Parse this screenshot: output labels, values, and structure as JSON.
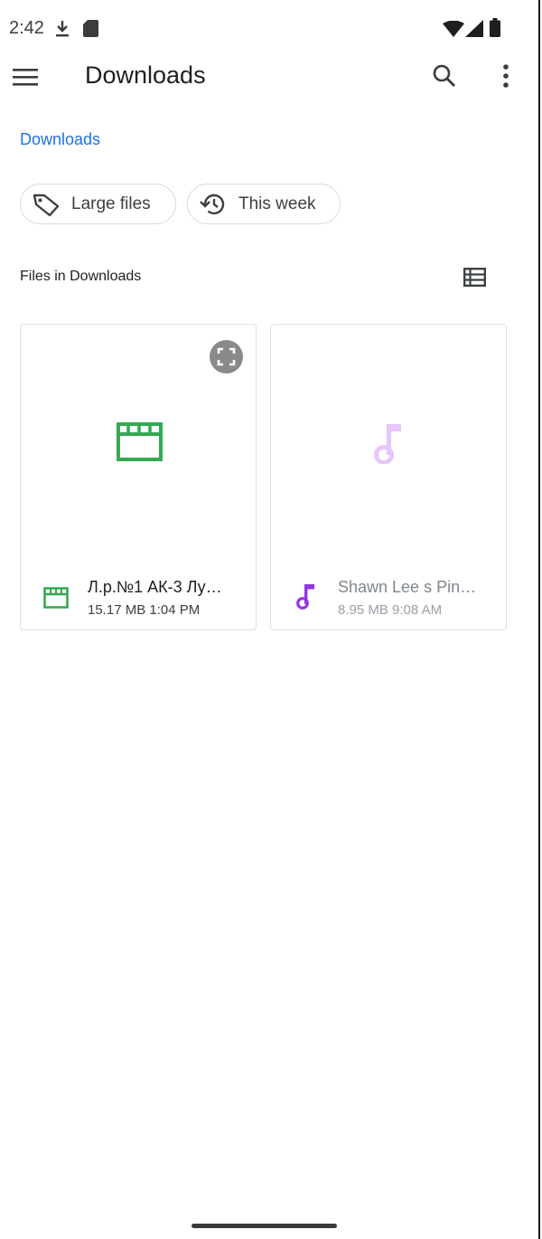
{
  "status_bar": {
    "time": "2:42",
    "icons": [
      "download-icon",
      "sd-card-icon",
      "wifi-icon",
      "cell-signal-icon",
      "battery-icon"
    ]
  },
  "app_bar": {
    "title": "Downloads",
    "icons": [
      "menu-icon",
      "search-icon",
      "more-vert-icon"
    ]
  },
  "breadcrumb": {
    "label": "Downloads",
    "color": "#1a73e8"
  },
  "chips": [
    {
      "label": "Large files",
      "icon": "label-tag-icon"
    },
    {
      "label": "This week",
      "icon": "history-icon"
    }
  ],
  "section": {
    "title": "Files in Downloads",
    "view_toggle_icon": "list-view-icon"
  },
  "files": [
    {
      "name": "Л.р.№1 АК-3 Лу…",
      "size": "15.17 MB",
      "time": "1:04 PM",
      "meta": "15.17 MB 1:04 PM",
      "type_icon": "movie-clapperboard-icon",
      "accent_color": "#34a853",
      "badge_icon": "fullscreen-expand-icon"
    },
    {
      "name": "Shawn Lee s Pin…",
      "size": "8.95 MB",
      "time": "9:08 AM",
      "meta": "8.95 MB 9:08 AM",
      "type_icon": "music-note-icon",
      "accent_color": "#9334e6",
      "thumb_color": "#e5c7fb"
    }
  ]
}
